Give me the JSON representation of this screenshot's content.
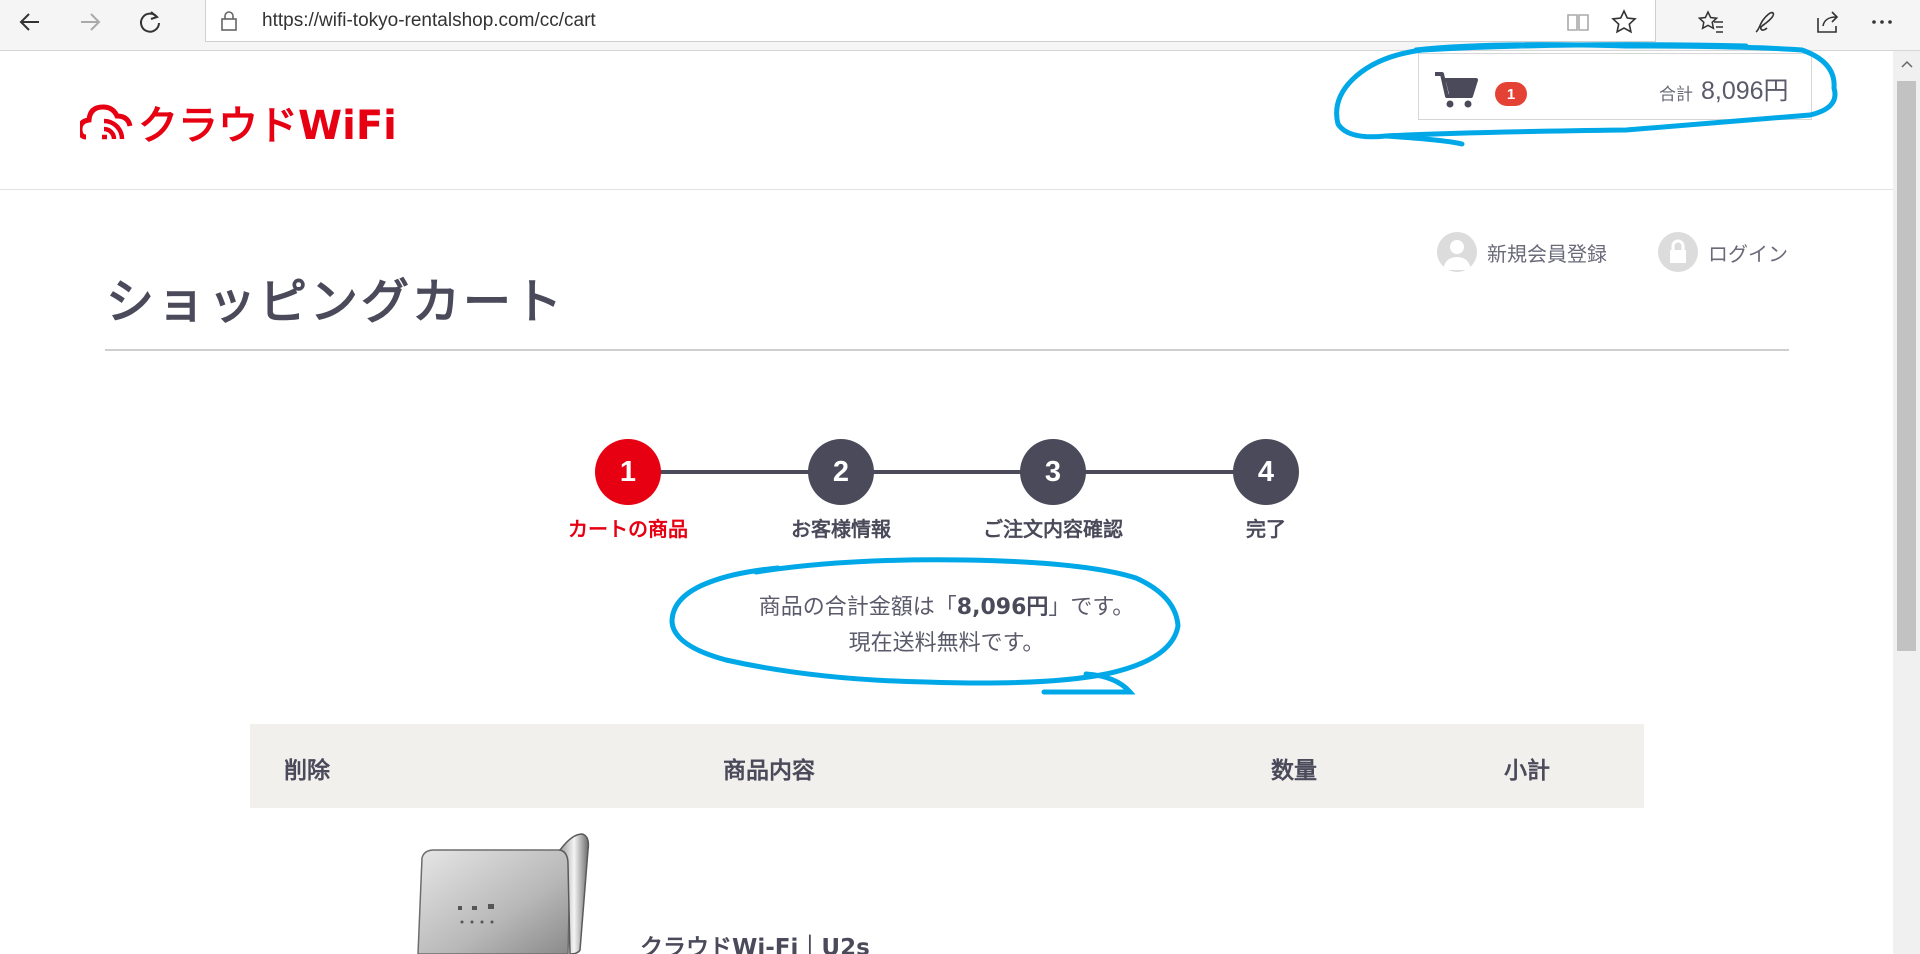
{
  "browser": {
    "url": "https://wifi-tokyo-rentalshop.com/cc/cart",
    "icons": [
      "back-arrow-icon",
      "forward-arrow-icon",
      "refresh-icon",
      "lock-icon",
      "reading-view-icon",
      "favorite-star-icon",
      "favorites-hub-icon",
      "pen-icon",
      "share-icon",
      "more-icon"
    ]
  },
  "header": {
    "logo_text": "クラウドWiFi",
    "cart": {
      "count": "1",
      "total_label": "合計",
      "total_value": "8,096円"
    }
  },
  "user_links": {
    "register": "新規会員登録",
    "login": "ログイン"
  },
  "page": {
    "title": "ショッピングカート"
  },
  "stepper": {
    "steps": [
      {
        "number": "1",
        "label": "カートの商品",
        "active": true
      },
      {
        "number": "2",
        "label": "お客様情報",
        "active": false
      },
      {
        "number": "3",
        "label": "ご注文内容確認",
        "active": false
      },
      {
        "number": "4",
        "label": "完了",
        "active": false
      }
    ]
  },
  "summary": {
    "line1_prefix": "商品の合計金額は「",
    "line1_amount": "8,096円",
    "line1_suffix": "」です。",
    "line2": "現在送料無料です。"
  },
  "table": {
    "headers": {
      "delete": "削除",
      "product": "商品内容",
      "quantity": "数量",
      "subtotal": "小計"
    },
    "items": [
      {
        "name": "クラウドWi-Fi｜U2s"
      }
    ]
  },
  "colors": {
    "brand_red": "#e60012",
    "dark": "#4a4a5a",
    "badge_red": "#e34234",
    "annotation_blue": "#00a8e8",
    "table_header_bg": "#f2f0ed"
  }
}
